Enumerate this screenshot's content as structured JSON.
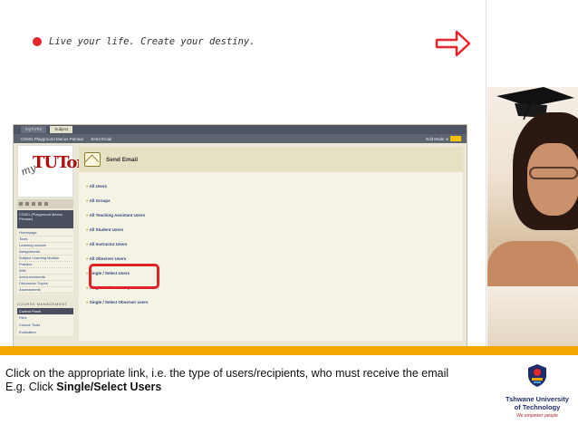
{
  "slide": {
    "tagline": "Live your life. Create your destiny.",
    "caption": {
      "line1": "Click on the appropriate link, i.e. the type of users/recipients, who must receive the email",
      "line2_prefix": "E.g. Click ",
      "line2_bold": "Single/Select Users"
    },
    "colors": {
      "accent_red": "#e8262c",
      "bar_yellow": "#f2a800"
    }
  },
  "embedded_screenshot": {
    "tabs": [
      "myTUTor",
      "Subject"
    ],
    "crumbs": [
      "CS601 Playground Marius Pienaar",
      "Send Email"
    ],
    "edit_mode_label": "Edit Mode is",
    "edit_mode_value": "ON",
    "logo_text_my": "my",
    "logo_text_tutor": "TUTor",
    "course_block": "CS601 (Playground Marius Pienaar)",
    "course_menu": [
      "Homepage",
      "Tools",
      "Learning module",
      "Assignments",
      "Subject Learning Module",
      "Practice",
      "Wiki",
      "Announcements",
      "Discussion Topics",
      "Assessments"
    ],
    "course_management_label": "COURSE MANAGEMENT",
    "control_panel_label": "Control Panel",
    "control_panel_items": [
      "Files",
      "Course Tools",
      "Evaluation"
    ],
    "page_title": "Send Email",
    "links": [
      "All Users",
      "All Groups",
      "All Teaching Assistant Users",
      "All Student Users",
      "All Instructor Users",
      "All Observer Users",
      "Single / Select Users",
      "Single / Select Groups",
      "Single / Select Observer users"
    ]
  },
  "brand": {
    "university_name_line1": "Tshwane University",
    "university_name_line2": "of Technology",
    "slogan": "We empower people"
  }
}
